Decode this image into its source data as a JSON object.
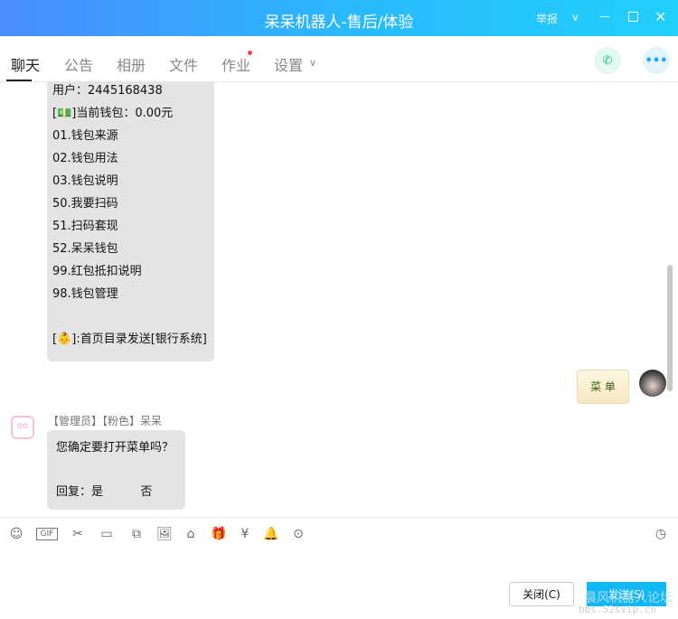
{
  "window": {
    "title": "呆呆机器人-售后/体验",
    "report": "举报"
  },
  "tabs": [
    {
      "label": "聊天"
    },
    {
      "label": "公告"
    },
    {
      "label": "相册"
    },
    {
      "label": "文件"
    },
    {
      "label": "作业"
    },
    {
      "label": "设置"
    }
  ],
  "messages": {
    "menu_lines": [
      "用户：2445168438",
      "[💵]当前钱包：0.00元",
      "01.钱包来源",
      "02.钱包用法",
      "03.钱包说明",
      "50.我要扫码",
      "51.扫码套现",
      "52.呆呆钱包",
      "99.红包抵扣说明",
      "98.钱包管理",
      "",
      "[👶]:首页目录发送[银行系统]"
    ],
    "sent_sticker": "菜 单",
    "sender": "【管理员】【粉色】呆呆",
    "confirm": "您确定要打开菜单吗？",
    "reply": "回复：是          否"
  },
  "actions": {
    "close": "关闭(C)",
    "send": "发送(S)"
  },
  "watermark": {
    "line1": "晨风机器人论坛",
    "line2": "bbs.52svip.cn"
  },
  "colors": {
    "title_start": "#4a8cfb",
    "title_end": "#21d0fd",
    "send": "#12b7f5"
  }
}
